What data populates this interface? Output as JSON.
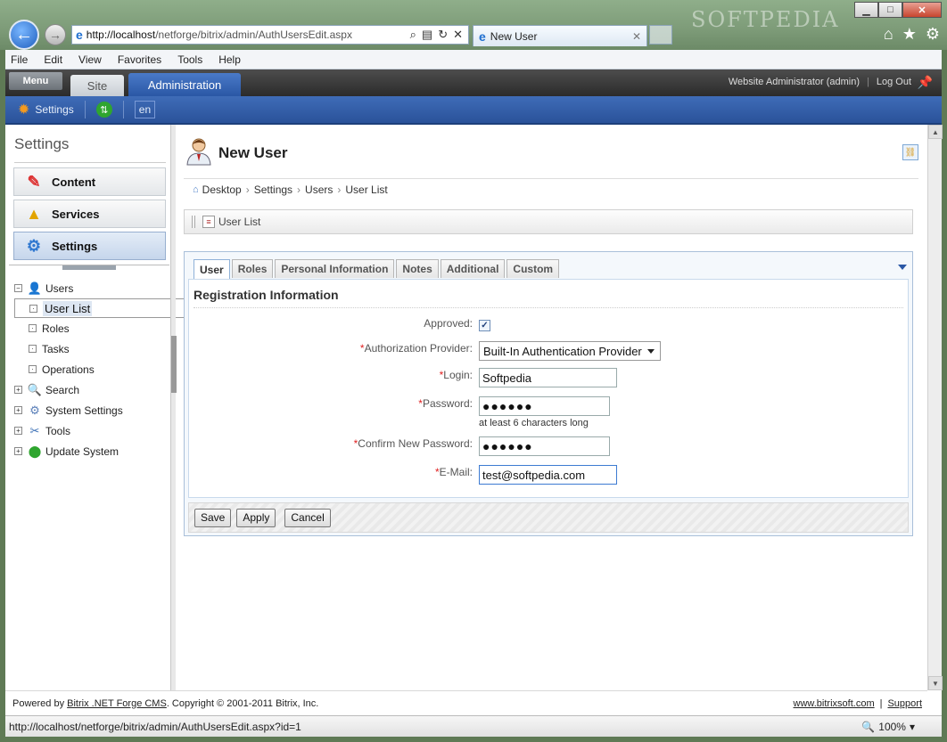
{
  "browser": {
    "address": {
      "host": "http://localhost",
      "path": "/netforge/bitrix/admin/AuthUsersEdit.aspx"
    },
    "tab_title": "New User",
    "menu": [
      "File",
      "Edit",
      "View",
      "Favorites",
      "Tools",
      "Help"
    ],
    "status_url": "http://localhost/netforge/bitrix/admin/AuthUsersEdit.aspx?id=1",
    "zoom": "100%",
    "watermark": "SOFTPEDIA"
  },
  "admin": {
    "menu_label": "Menu",
    "site_tab": "Site",
    "admin_tab": "Administration",
    "user": "Website Administrator (admin)",
    "logout": "Log Out",
    "toolbar_settings": "Settings",
    "lang": "en"
  },
  "sidebar": {
    "title": "Settings",
    "buttons": [
      {
        "label": "Content",
        "icon": "pencil-icon"
      },
      {
        "label": "Services",
        "icon": "services-icon"
      },
      {
        "label": "Settings",
        "icon": "gear-icon"
      }
    ],
    "tree": [
      {
        "label": "Users",
        "expander": "−",
        "icon": "users-icon"
      },
      {
        "label": "User List"
      },
      {
        "label": "Roles"
      },
      {
        "label": "Tasks"
      },
      {
        "label": "Operations"
      },
      {
        "label": "Search",
        "expander": "+",
        "icon": "search-icon"
      },
      {
        "label": "System Settings",
        "expander": "+",
        "icon": "gear-icon"
      },
      {
        "label": "Tools",
        "expander": "+",
        "icon": "tools-icon"
      },
      {
        "label": "Update System",
        "expander": "+",
        "icon": "update-icon"
      }
    ]
  },
  "main": {
    "title": "New User",
    "breadcrumbs": [
      "Desktop",
      "Settings",
      "Users",
      "User List"
    ],
    "context_link": "User List",
    "tabs": [
      "User",
      "Roles",
      "Personal Information",
      "Notes",
      "Additional",
      "Custom"
    ],
    "section": "Registration Information",
    "fields": {
      "approved": {
        "label": "Approved:",
        "checked": true
      },
      "provider": {
        "label": "Authorization Provider:",
        "value": "Built-In Authentication Provider"
      },
      "login": {
        "label": "Login:",
        "value": "Softpedia"
      },
      "password": {
        "label": "Password:",
        "value": "●●●●●●",
        "hint": "at least 6 characters long"
      },
      "confirm": {
        "label": "Confirm New Password:",
        "value": "●●●●●●"
      },
      "email": {
        "label": "E-Mail:",
        "value": "test@softpedia.com"
      }
    },
    "buttons": {
      "save": "Save",
      "apply": "Apply",
      "cancel": "Cancel"
    }
  },
  "footer": {
    "powered": "Powered by",
    "product": "Bitrix .NET Forge CMS",
    "copyright": ". Copyright © 2001-2011 Bitrix, Inc.",
    "site": "www.bitrixsoft.com",
    "support": "Support"
  }
}
